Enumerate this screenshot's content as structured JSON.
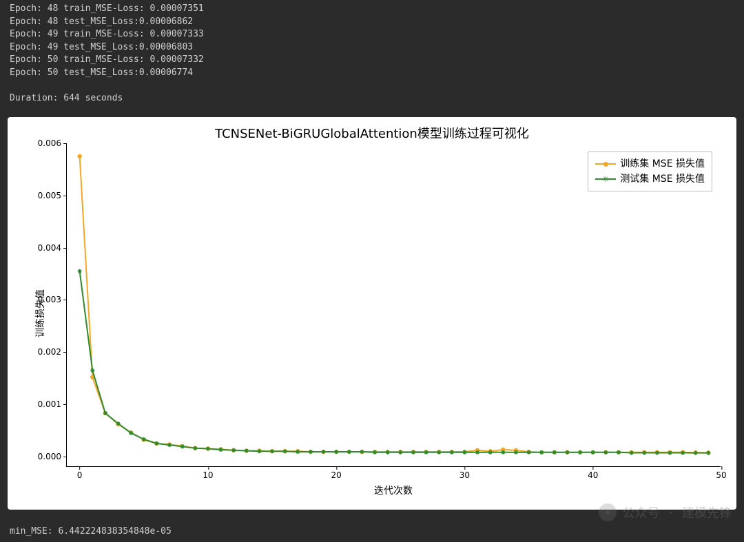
{
  "console_lines": [
    "Epoch: 48 train_MSE-Loss: 0.00007351",
    "Epoch: 48 test_MSE_Loss:0.00006862",
    "Epoch: 49 train_MSE-Loss: 0.00007333",
    "Epoch: 49 test_MSE_Loss:0.00006803",
    "Epoch: 50 train_MSE-Loss: 0.00007332",
    "Epoch: 50 test_MSE_Loss:0.00006774",
    "",
    "Duration: 644 seconds"
  ],
  "footer": "min_MSE: 6.442224838354848e-05",
  "watermark": "公众号 · 建模先锋",
  "chart_data": {
    "type": "line",
    "title": "TCNSENet-BiGRUGlobalAttention模型训练过程可视化",
    "xlabel": "迭代次数",
    "ylabel": "训练损失值",
    "xlim": [
      -1,
      50
    ],
    "ylim": [
      -0.0002,
      0.006
    ],
    "x_ticks": [
      0,
      10,
      20,
      30,
      40,
      50
    ],
    "y_ticks": [
      0.0,
      0.001,
      0.002,
      0.003,
      0.004,
      0.005,
      0.006
    ],
    "y_tick_labels": [
      "0.000",
      "0.001",
      "0.002",
      "0.003",
      "0.004",
      "0.005",
      "0.006"
    ],
    "x": [
      0,
      1,
      2,
      3,
      4,
      5,
      6,
      7,
      8,
      9,
      10,
      11,
      12,
      13,
      14,
      15,
      16,
      17,
      18,
      19,
      20,
      21,
      22,
      23,
      24,
      25,
      26,
      27,
      28,
      29,
      30,
      31,
      32,
      33,
      34,
      35,
      36,
      37,
      38,
      39,
      40,
      41,
      42,
      43,
      44,
      45,
      46,
      47,
      48,
      49
    ],
    "series": [
      {
        "name": "训练集 MSE 损失值",
        "color": "#f5a623",
        "marker": "circle",
        "values": [
          0.00575,
          0.00152,
          0.00083,
          0.00062,
          0.00046,
          0.00032,
          0.00025,
          0.00023,
          0.0002,
          0.00016,
          0.00015,
          0.00014,
          0.00012,
          0.00011,
          0.00011,
          0.0001,
          0.0001,
          0.0001,
          9e-05,
          9e-05,
          9e-05,
          9e-05,
          9e-05,
          9e-05,
          9e-05,
          9e-05,
          9e-05,
          9e-05,
          9e-05,
          9e-05,
          9e-05,
          0.00012,
          0.0001,
          0.00013,
          0.00012,
          9e-05,
          8e-05,
          8e-05,
          8e-05,
          8e-05,
          8e-05,
          8e-05,
          8e-05,
          8e-05,
          8e-05,
          8e-05,
          8e-05,
          8e-05,
          7.4e-05,
          7.3e-05
        ]
      },
      {
        "name": "测试集 MSE 损失值",
        "color": "#2e8b2e",
        "marker": "star",
        "values": [
          0.00355,
          0.00165,
          0.00083,
          0.00063,
          0.00045,
          0.00033,
          0.00025,
          0.00022,
          0.00019,
          0.00016,
          0.00015,
          0.00013,
          0.00012,
          0.00011,
          0.0001,
          0.0001,
          0.0001,
          9e-05,
          9e-05,
          9e-05,
          9e-05,
          9e-05,
          9e-05,
          8e-05,
          8e-05,
          8e-05,
          8e-05,
          8e-05,
          8e-05,
          8e-05,
          8e-05,
          8e-05,
          8e-05,
          8e-05,
          8e-05,
          8e-05,
          8e-05,
          8e-05,
          8e-05,
          8e-05,
          8e-05,
          8e-05,
          8e-05,
          7e-05,
          7e-05,
          7e-05,
          7e-05,
          7e-05,
          6.9e-05,
          6.8e-05
        ]
      }
    ],
    "legend_position": "upper right"
  }
}
